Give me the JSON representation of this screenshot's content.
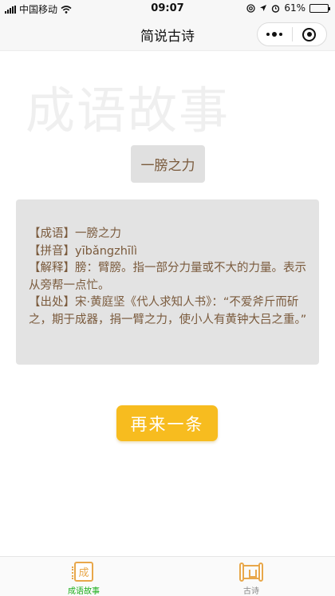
{
  "status_bar": {
    "carrier": "中国移动",
    "time": "09:07",
    "battery_percent": "61%",
    "battery_level": 0.61
  },
  "nav": {
    "title": "简说古诗"
  },
  "main": {
    "watermark": "成语故事",
    "idiom": "一膀之力",
    "story": {
      "idiom_line": "【成语】一膀之力",
      "pinyin_line": "【拼音】yībǎngzhīlì",
      "meaning_line": "【解释】膀：臂膀。指一部分力量或不大的力量。表示从旁帮一点忙。",
      "source_line": "【出处】宋·黄庭坚《代人求知人书》：“不爱斧斤而斫之，期于成器，捐一臂之力，使小人有黄钟大吕之重。”"
    },
    "again_button": "再来一条"
  },
  "tabs": [
    {
      "label": "成语故事",
      "icon_char": "成",
      "icon": "idiom-book-icon",
      "active": true
    },
    {
      "label": "古诗",
      "icon": "scroll-icon",
      "active": false
    }
  ],
  "colors": {
    "accent_button": "#f7bc1f",
    "text_brown": "#7a5a3c",
    "tab_active": "#1aad19",
    "icon_orange": "#e8a74a"
  }
}
